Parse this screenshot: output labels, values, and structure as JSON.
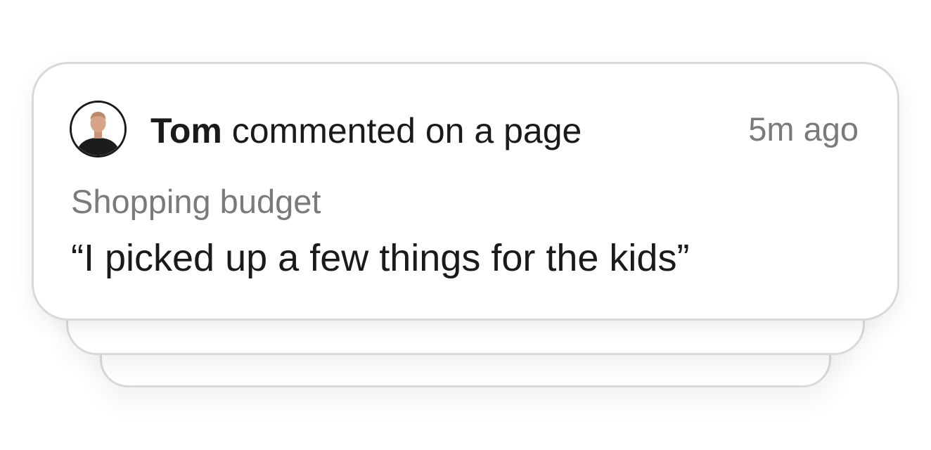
{
  "notification": {
    "user_name": "Tom",
    "action_text": "commented on a page",
    "timestamp": "5m ago",
    "page_title": "Shopping budget",
    "comment": "“I picked up a few things for the kids”"
  },
  "colors": {
    "primary_text": "#1a1a1a",
    "secondary_text": "#7a7a7a",
    "card_border": "#d9d9d9",
    "background": "#ffffff"
  },
  "icons": {
    "avatar": "user-avatar-photo"
  }
}
